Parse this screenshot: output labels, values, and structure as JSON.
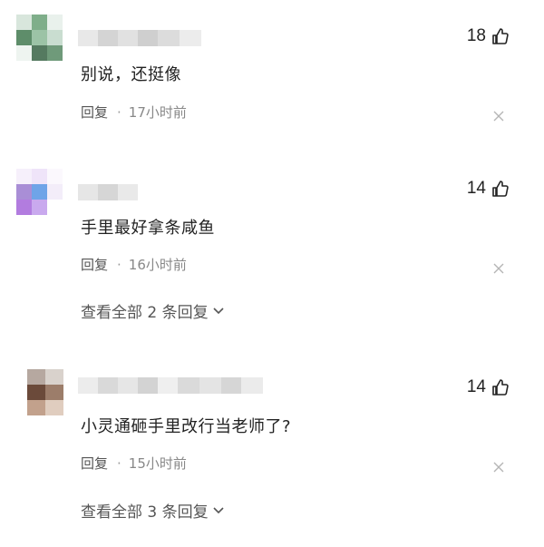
{
  "comments": [
    {
      "likes": "18",
      "text": "别说，还挺像",
      "reply_label": "回复",
      "dot": "·",
      "time": "17小时前"
    },
    {
      "likes": "14",
      "text": "手里最好拿条咸鱼",
      "reply_label": "回复",
      "dot": "·",
      "time": "16小时前",
      "view_replies": "查看全部 2 条回复"
    },
    {
      "likes": "14",
      "text": "小灵通砸手里改行当老师了?",
      "reply_label": "回复",
      "dot": "·",
      "time": "15小时前",
      "view_replies": "查看全部 3 条回复"
    }
  ],
  "icons": {
    "like": "thumbs-up-icon",
    "close": "close-icon",
    "chevron": "chevron-down-icon"
  }
}
